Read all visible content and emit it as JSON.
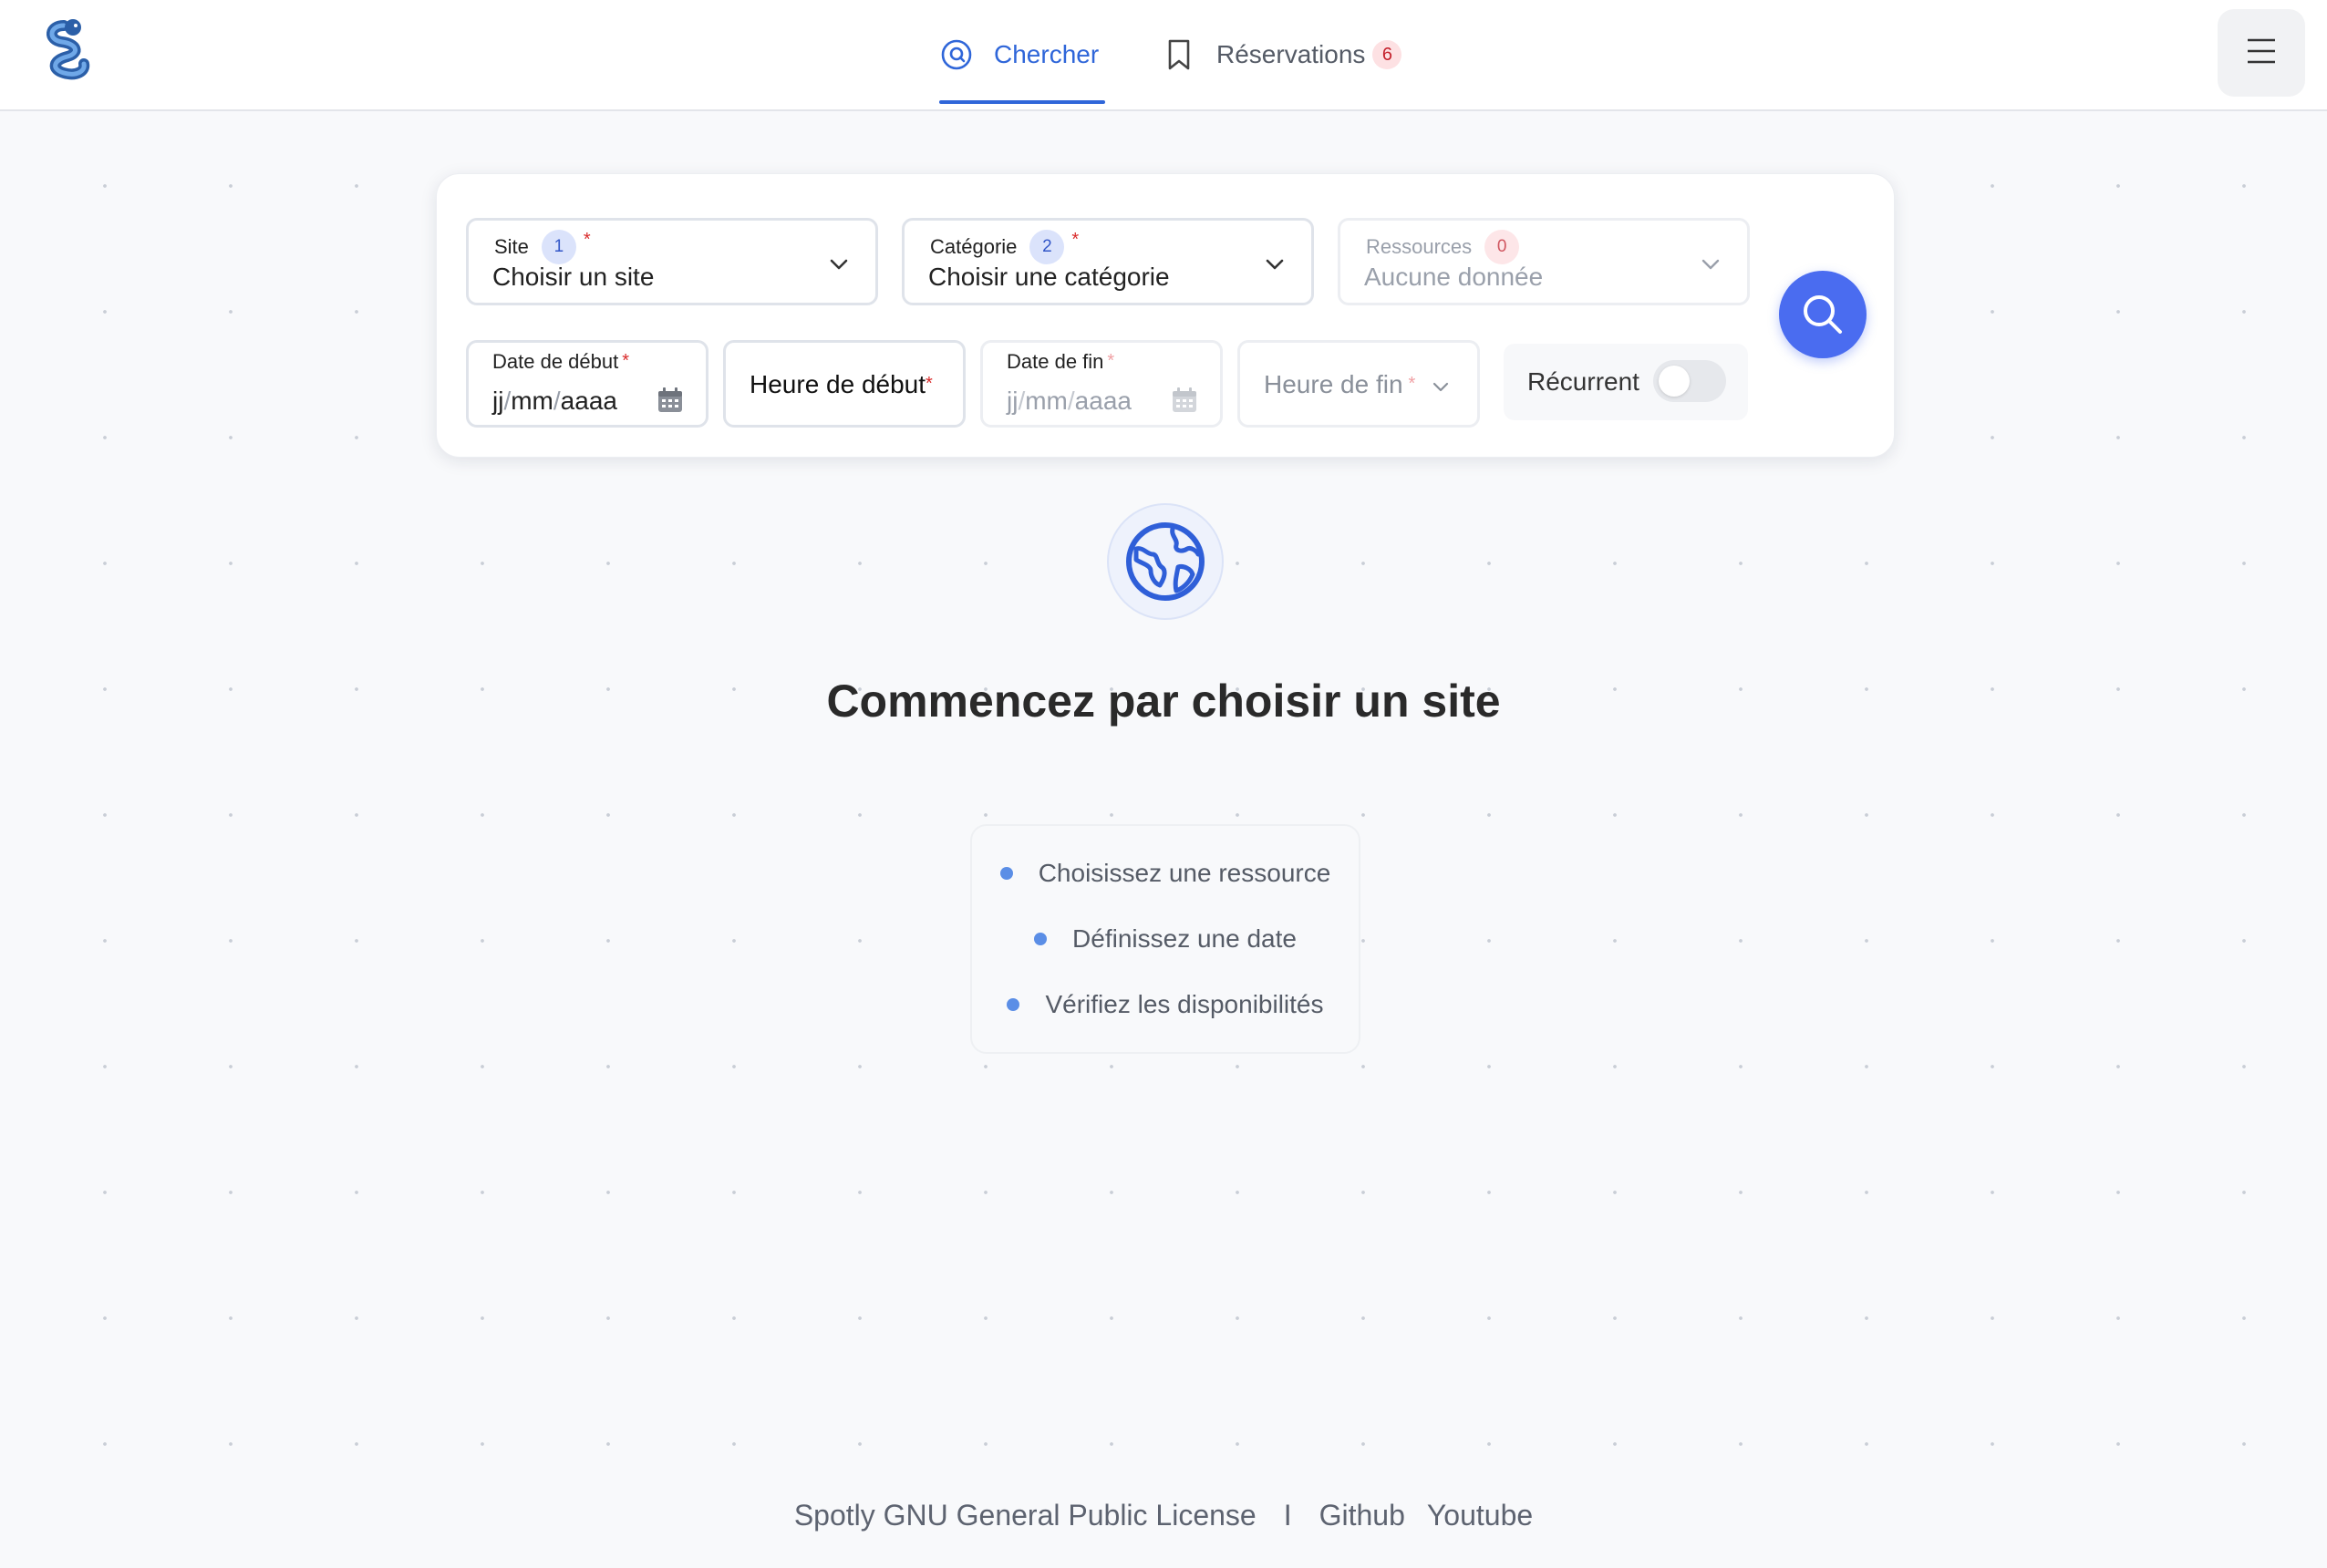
{
  "header": {
    "logo_name": "snake-logo",
    "tabs": [
      {
        "label": "Chercher",
        "icon": "search-at-icon",
        "active": true
      },
      {
        "label": "Réservations",
        "icon": "bookmark-icon",
        "count": "6"
      }
    ]
  },
  "search": {
    "site": {
      "label": "Site",
      "badge": "1",
      "required": "*",
      "value": "Choisir un site"
    },
    "category": {
      "label": "Catégorie",
      "badge": "2",
      "required": "*",
      "value": "Choisir une catégorie"
    },
    "resources": {
      "label": "Ressources",
      "badge": "0",
      "value": "Aucune donnée"
    },
    "start_date": {
      "label": "Date de début",
      "required": "*",
      "dd": "jj",
      "mm": "mm",
      "yyyy": "aaaa",
      "sep": "/"
    },
    "start_time": {
      "label": "Heure de début",
      "required": "*"
    },
    "end_date": {
      "label": "Date de fin",
      "required": "*",
      "dd": "jj",
      "mm": "mm",
      "yyyy": "aaaa",
      "sep": "/"
    },
    "end_time": {
      "label": "Heure de fin",
      "required": "*"
    },
    "recurring": {
      "label": "Récurrent",
      "on": false
    }
  },
  "empty_state": {
    "title": "Commencez par choisir un site",
    "steps": [
      "Choisissez une ressource",
      "Définissez une date",
      "Vérifiez les disponibilités"
    ]
  },
  "footer": {
    "license": "Spotly GNU General Public License",
    "separator": "I",
    "links": [
      "Github",
      "Youtube"
    ]
  },
  "colors": {
    "accent": "#2f66d9",
    "search_button": "#4a6cf0",
    "badge_red": "#c4202b",
    "step_dot": "#5b8ee6"
  }
}
